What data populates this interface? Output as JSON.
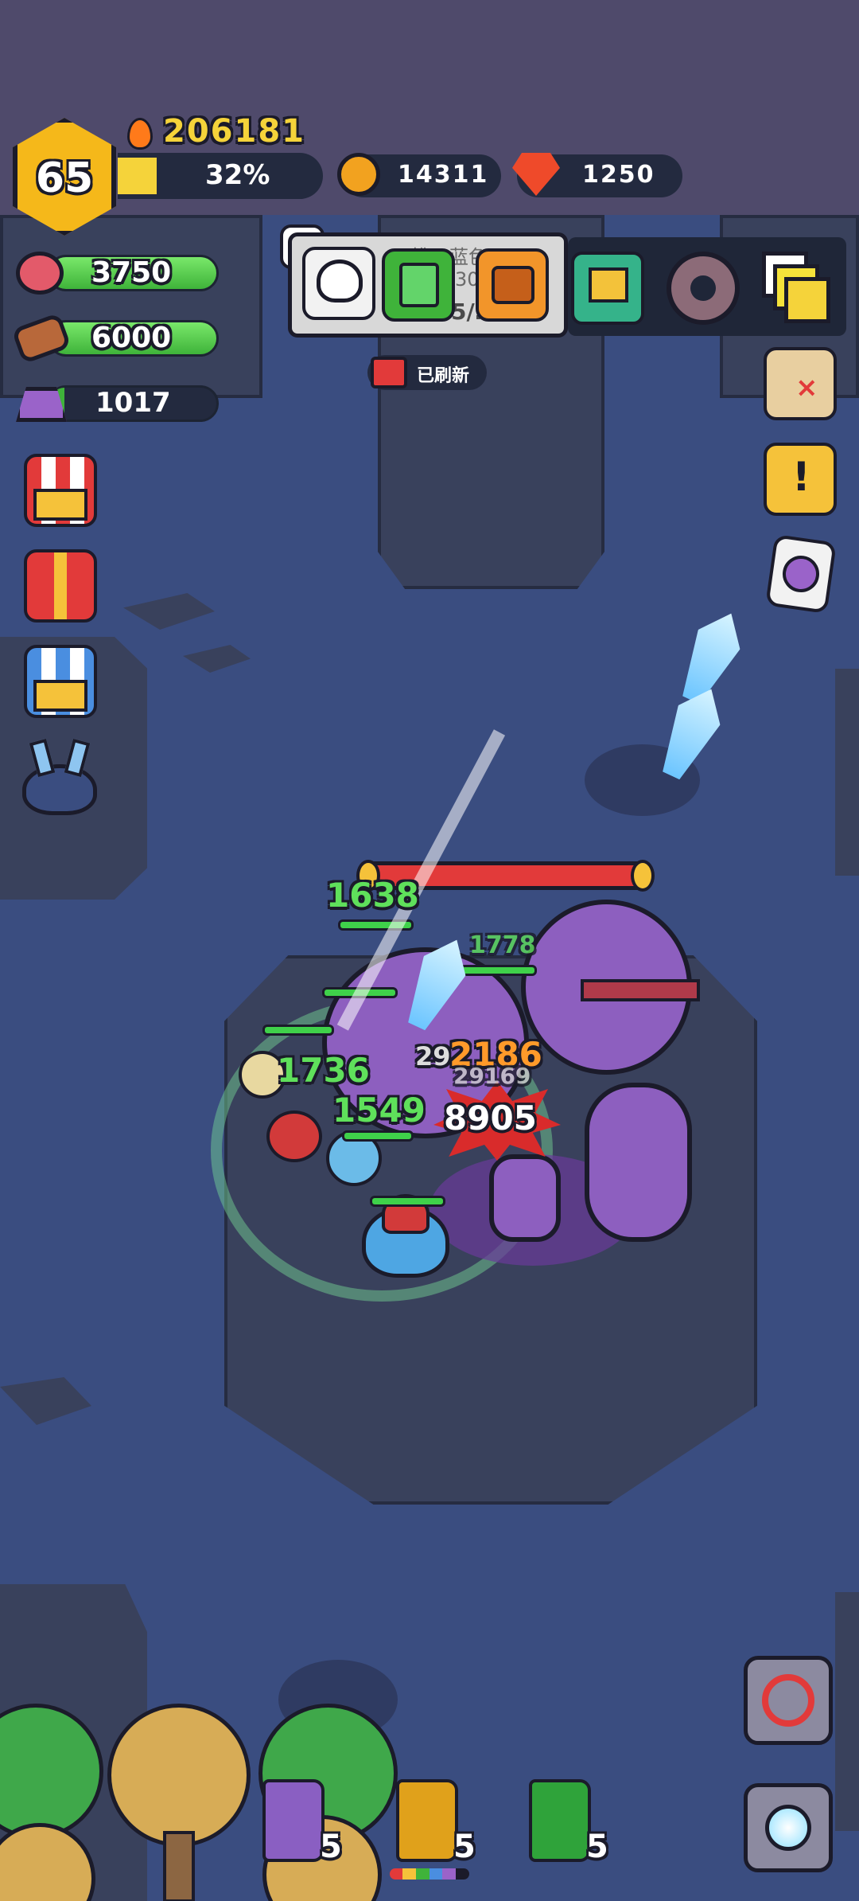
{
  "player": {
    "level": "65",
    "power": "206181",
    "exp_percent_label": "32%",
    "exp_fraction": 0.32
  },
  "currencies": {
    "gold": "14311",
    "gems": "1250"
  },
  "resources": {
    "meat": "3750",
    "wood": "6000",
    "ore": "1017"
  },
  "quest_banner": {
    "title_partial": "挑…蓝色…",
    "progress_partial": "30",
    "progress_partial_2": "5/…"
  },
  "refresh_label": "已刷新",
  "top_buttons": [
    "search-icon",
    "skull-icon",
    "green-book-icon",
    "orange-chest-icon",
    "mail-icon",
    "gear-icon",
    "layers-icon"
  ],
  "right_buttons": [
    "treasure-map-icon",
    "quest-scroll-icon",
    "potion-skull-icon"
  ],
  "left_buttons": [
    "shop-icon",
    "gift-icon",
    "store-icon",
    "monster-icon"
  ],
  "combat_numbers": {
    "heal_1": "1638",
    "heal_2": "1778",
    "heal_3": "1736",
    "heal_4": "1549",
    "damage_orange": "2186",
    "damage_gray_1": "29",
    "damage_gray_2": "29169",
    "crit": "8905"
  },
  "boss_hp_fraction": 1.0,
  "skill_books": [
    {
      "icon": "lightning-book-icon",
      "count": "5",
      "color": "#8a5fc2"
    },
    {
      "icon": "wing-book-icon",
      "count": "5",
      "color": "#e0a11b"
    },
    {
      "icon": "heal-book-icon",
      "count": "5",
      "color": "#2fa33a"
    }
  ],
  "bottom_right_buttons": [
    "sword-auto-icon",
    "portal-icon"
  ],
  "colors": {
    "floor": "#3a4d80",
    "wall": "#4f4a6b",
    "stone": "#39415c",
    "gold": "#f5d33a",
    "green": "#5fe05b",
    "red": "#e23a3a",
    "boss": "#8d5fbf"
  }
}
